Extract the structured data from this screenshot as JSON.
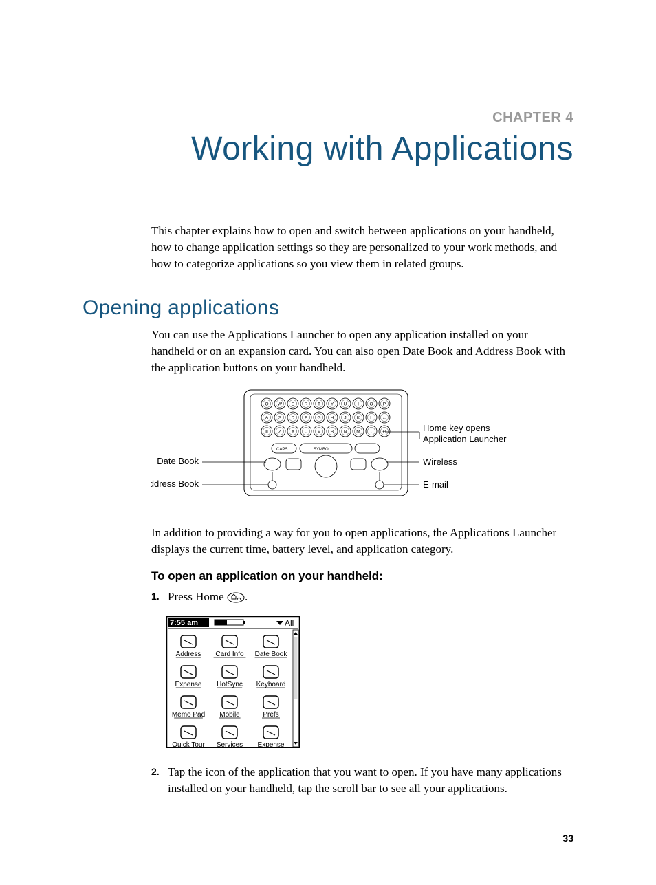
{
  "chapter": {
    "label": "CHAPTER 4",
    "title": "Working with Applications"
  },
  "intro": "This chapter explains how to open and switch between applications on your handheld, how to change application settings so they are personalized to your work methods, and how to categorize applications so you view them in related groups.",
  "section": {
    "title": "Opening applications",
    "p1": "You can use the Applications Launcher to open any application installed on your handheld or on an expansion card. You can also open Date Book and Address Book with the application buttons on your handheld.",
    "p2": "In addition to providing a way for you to open applications, the Applications Launcher displays the current time, battery level, and application category.",
    "proc_head": "To open an application on your handheld:",
    "step1_pre": "Press Home ",
    "step1_post": ".",
    "step2": "Tap the icon of the application that you want to open. If you have many applications installed on your handheld, tap the scroll bar to see all your applications."
  },
  "keyboard_diagram": {
    "row1": [
      "Q",
      "W",
      "E",
      "R",
      "T",
      "Y",
      "U",
      "I",
      "O",
      "P"
    ],
    "row2": [
      "A",
      "S",
      "D",
      "F",
      "G",
      "H",
      "J",
      "K",
      "L",
      "←"
    ],
    "row3": [
      "≡",
      "Z",
      "X",
      "C",
      "V",
      "B",
      "N",
      "M",
      ".",
      "↵"
    ],
    "row4_caps": "CAPS",
    "row4_symbol": "SYMBOL",
    "callouts": {
      "date_book": "Date Book",
      "address_book": "Address Book",
      "home": "Home key opens Application Launcher",
      "wireless": "Wireless",
      "email": "E-mail"
    }
  },
  "launcher": {
    "time": "7:55 am",
    "category": "All",
    "apps": [
      [
        "Address",
        "Card Info",
        "Date Book"
      ],
      [
        "Expense",
        "HotSync",
        "Keyboard"
      ],
      [
        "Memo Pad",
        "Mobile",
        "Prefs"
      ],
      [
        "Quick Tour",
        "Services",
        "Expense"
      ]
    ]
  },
  "page_number": "33"
}
